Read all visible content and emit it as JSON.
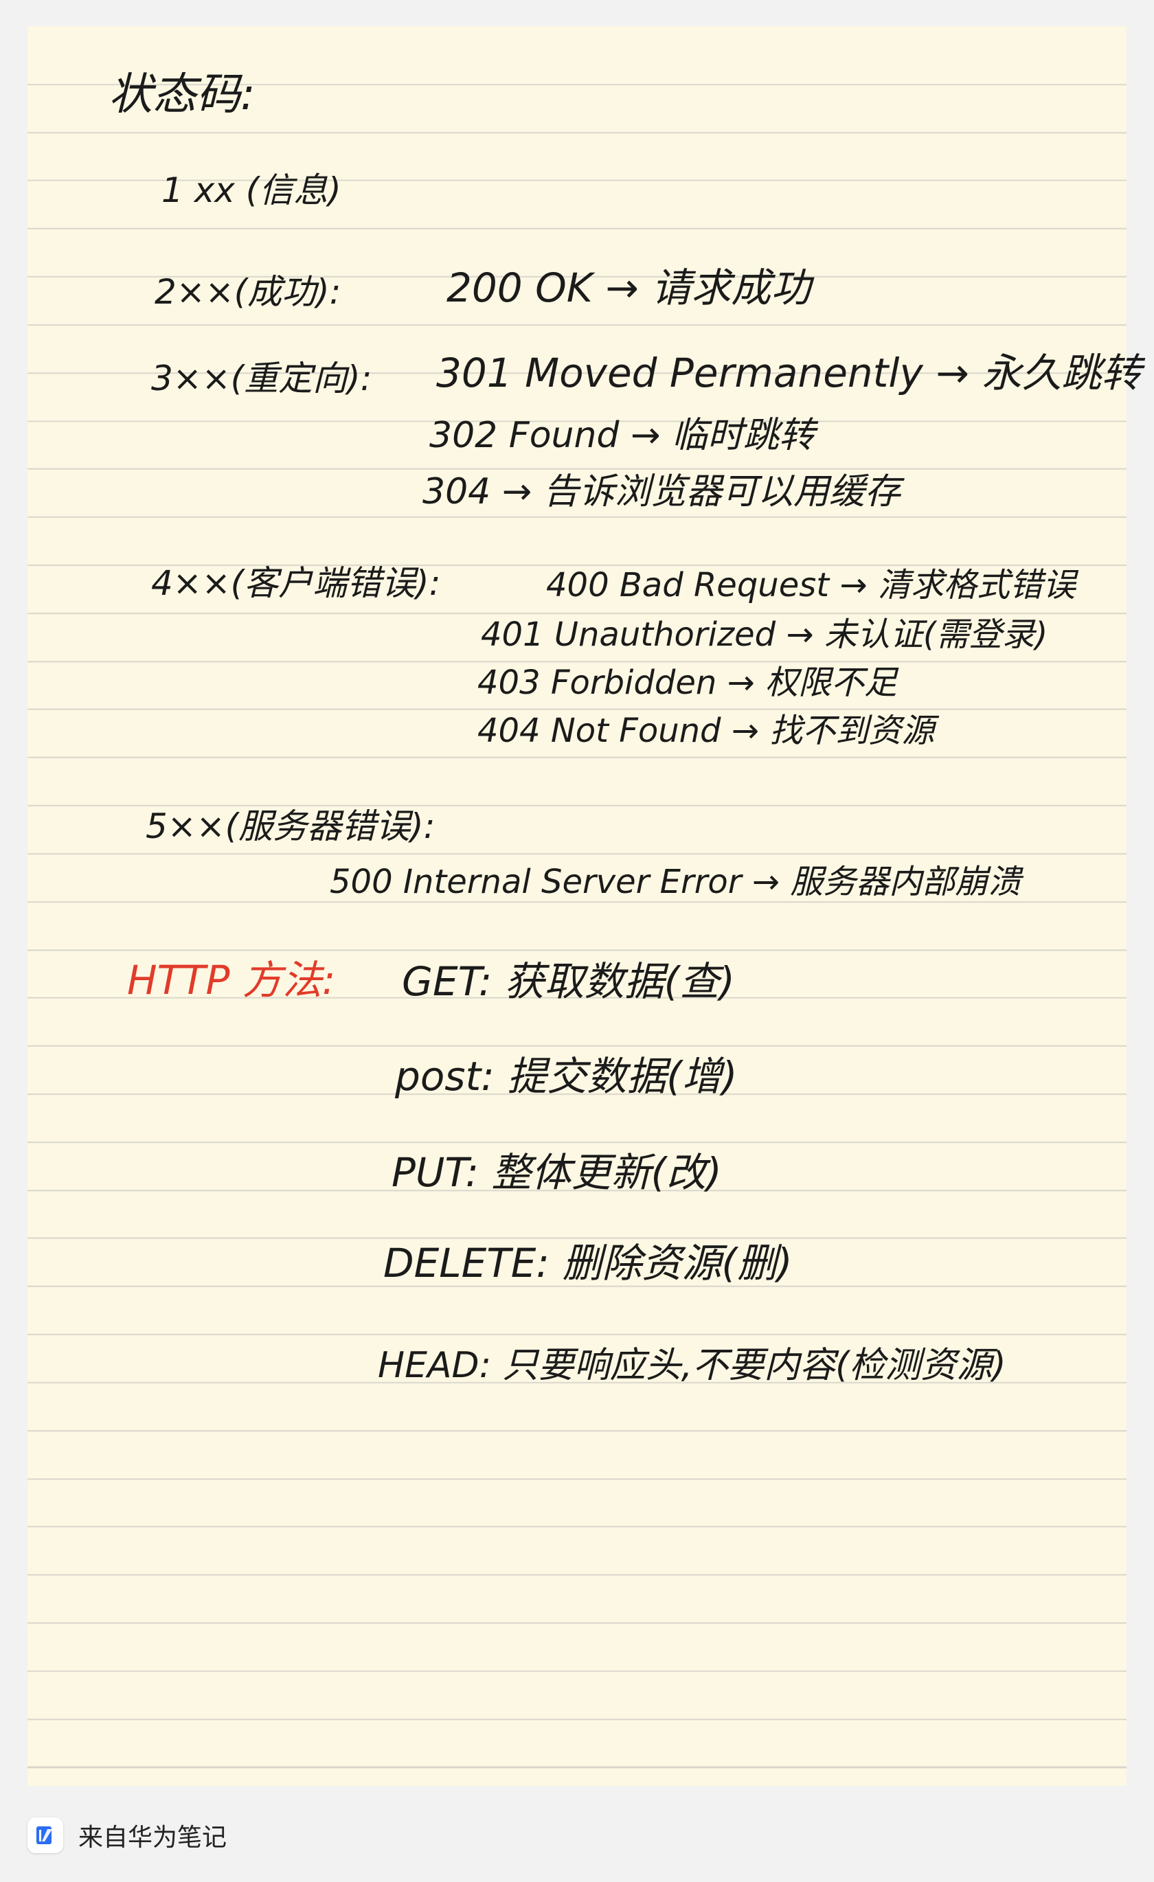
{
  "note": {
    "title": "状态码:",
    "status": {
      "c1": {
        "label": "1 xx (信息)"
      },
      "c2": {
        "label": "2××(成功):",
        "items": [
          "200 OK → 请求成功"
        ]
      },
      "c3": {
        "label": "3××(重定向):",
        "items": [
          "301 Moved Permanently → 永久跳转",
          "302 Found → 临时跳转",
          "304 → 告诉浏览器可以用缓存"
        ]
      },
      "c4": {
        "label": "4××(客户端错误):",
        "items": [
          "400 Bad Request → 清求格式错误",
          "401 Unauthorized → 未认证(需登录)",
          "403 Forbidden → 权限不足",
          "404 Not Found → 找不到资源"
        ]
      },
      "c5": {
        "label": "5××(服务器错误):",
        "items": [
          "500 Internal Server Error → 服务器内部崩溃"
        ]
      }
    },
    "methods": {
      "heading": "HTTP 方法:",
      "items": [
        "GET: 获取数据(查)",
        "post: 提交数据(增)",
        "PUT: 整体更新(改)",
        "DELETE: 删除资源(删)",
        "HEAD: 只要响应头,不要内容(检测资源)"
      ]
    }
  },
  "footer": {
    "source": "来自华为笔记",
    "icon": "pen-note-icon",
    "icon_color": "#2a6df4"
  },
  "colors": {
    "paper": "#fcf8e3",
    "rule_line": "#d9d6cc",
    "ink": "#1b1b1b",
    "heading_red": "#e23b2a"
  }
}
